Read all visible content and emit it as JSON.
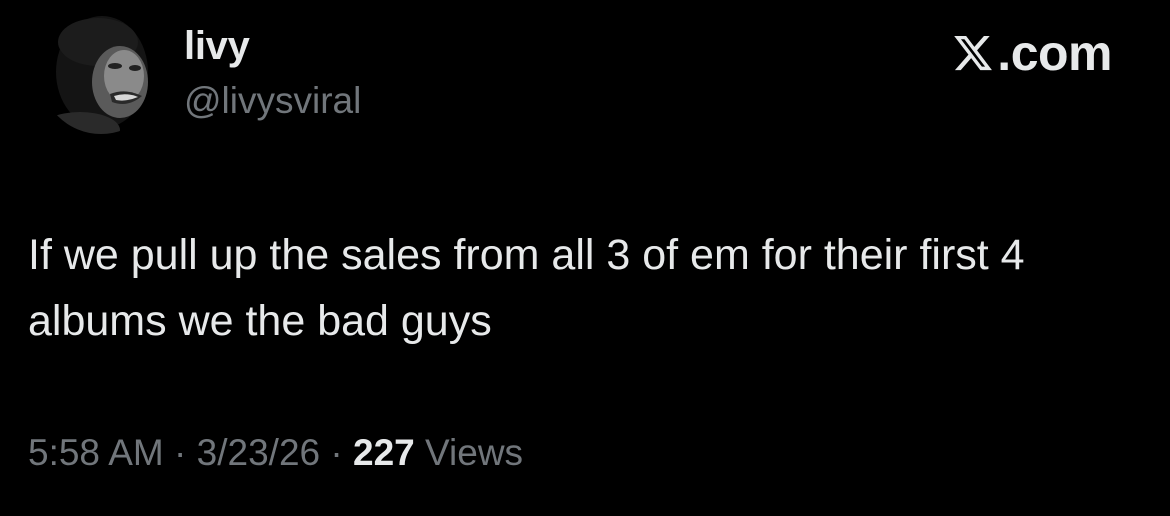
{
  "author": {
    "display_name": "livy",
    "handle": "@livysviral"
  },
  "brand": {
    "label": ".com",
    "icon": "x-logo-icon"
  },
  "tweet": {
    "text": "If we pull up the sales from all 3 of em for their first 4 albums we the bad guys"
  },
  "meta": {
    "time": "5:58 AM",
    "separator": " · ",
    "date": "3/23/26",
    "views_count": "227",
    "views_label": "Views"
  },
  "colors": {
    "background": "#000000",
    "primary_text": "#e7e9ea",
    "secondary_text": "#71767b"
  }
}
